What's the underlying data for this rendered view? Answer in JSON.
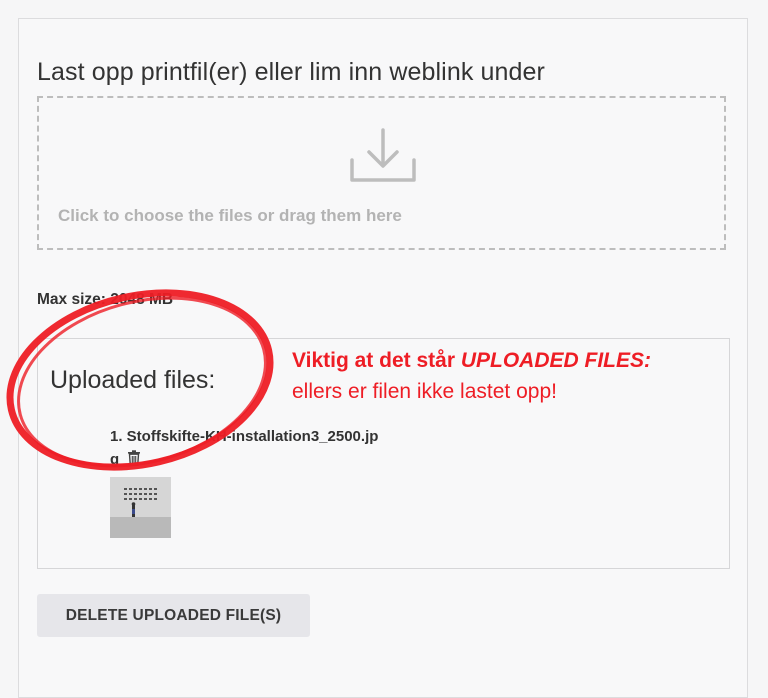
{
  "upload": {
    "title": "Last opp printfil(er) eller lim inn weblink under",
    "dropzone_text": "Click to choose the files or drag them here",
    "dropzone_icon": "download-icon",
    "max_size": "Max size: 2048 MB"
  },
  "uploaded": {
    "title": "Uploaded files:",
    "files": [
      {
        "name": "1. Stoffskifte-KH-installation3_2500.jpg",
        "delete_icon": "trash-icon"
      }
    ]
  },
  "annotation": {
    "line1_prefix": "Viktig at det står ",
    "line1_emphasis": "UPLOADED FILES:",
    "line2": "ellers er filen ikke lastet opp!",
    "color": "#ee1d25"
  },
  "actions": {
    "delete_label": "DELETE UPLOADED FILE(S)"
  }
}
